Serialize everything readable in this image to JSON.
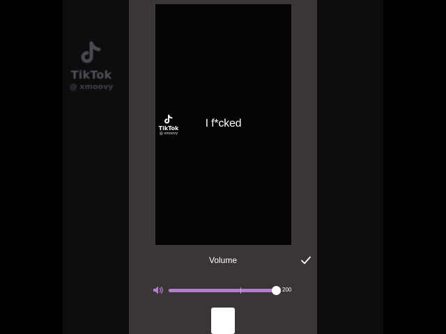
{
  "background_watermark": {
    "brand": "TikTok",
    "handle": "@ xmoovy"
  },
  "preview": {
    "watermark": {
      "brand": "TikTok",
      "handle": "@ xmoovy"
    },
    "caption": "I f*cked"
  },
  "volume_panel": {
    "title": "Volume",
    "value": "200",
    "level_fraction": 1.0,
    "confirm_icon": "checkmark-icon",
    "speaker_icon": "speaker-volume-icon"
  },
  "colors": {
    "panel_bg": "#3a3638",
    "slider_fill": "#b57fd0",
    "slider_track": "#6f5a7a",
    "speaker_icon": "#b57fd0"
  }
}
